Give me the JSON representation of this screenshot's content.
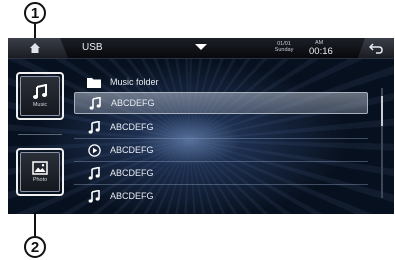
{
  "callouts": {
    "one": "1",
    "two": "2"
  },
  "topbar": {
    "source": "USB",
    "date_line1": "01/01",
    "date_line2": "Sunday",
    "ampm": "AM",
    "time": "00:16"
  },
  "sidebar": {
    "music_label": "Music",
    "photo_label": "Photo"
  },
  "list": {
    "items": [
      {
        "icon": "folder-icon",
        "label": "Music folder"
      },
      {
        "icon": "music-note-icon",
        "label": "ABCDEFG"
      },
      {
        "icon": "music-note-icon",
        "label": "ABCDEFG"
      },
      {
        "icon": "play-circle-icon",
        "label": "ABCDEFG"
      },
      {
        "icon": "music-note-icon",
        "label": "ABCDEFG"
      },
      {
        "icon": "music-note-icon",
        "label": "ABCDEFG"
      }
    ]
  },
  "colors": {
    "background": "#07101e",
    "selected_row": "#8a93a3",
    "text": "#e8ecf2"
  }
}
